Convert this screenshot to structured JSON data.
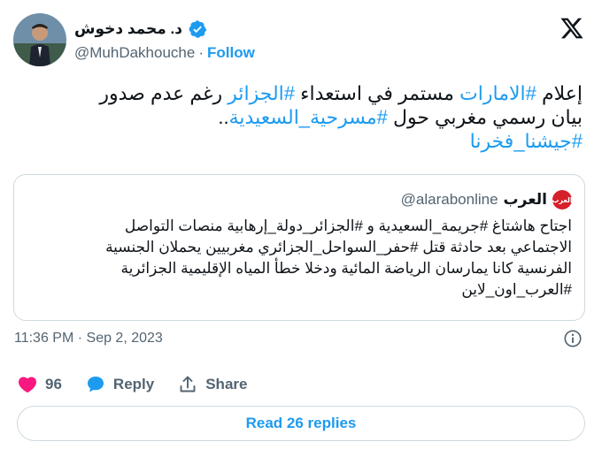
{
  "author": {
    "name": "د. محمد دخوش",
    "handle": "@MuhDakhouche",
    "separator": "·",
    "follow_label": "Follow"
  },
  "tweet": {
    "line1": [
      {
        "text": "إعلام ",
        "tag": false
      },
      {
        "text": "#الامارات",
        "tag": true
      },
      {
        "text": " مستمر في استعداء ",
        "tag": false
      },
      {
        "text": "#الجزائر",
        "tag": true
      },
      {
        "text": " رغم عدم صدور",
        "tag": false
      }
    ],
    "line2": [
      {
        "text": "بيان رسمي مغربي حول ",
        "tag": false
      },
      {
        "text": "#مسرحية_السعيدية",
        "tag": true
      },
      {
        "text": "..",
        "tag": false
      }
    ],
    "line3": [
      {
        "text": "#جيشنا_فخرنا",
        "tag": true
      }
    ]
  },
  "quote": {
    "avatar_text": "العرب",
    "name": "العرب",
    "handle": "@alarabonline",
    "text_lines": [
      "اجتاح هاشتاغ #جريمة_السعيدية  و #الجزائر_دولة_إرهابية منصات التواصل",
      "الاجتماعي بعد حادثة قتل #حفر_السواحل_الجزائري مغربيين يحملان الجنسية",
      "الفرنسية كانا يمارسان الرياضة المائية ودخلا خطأ المياه الإقليمية الجزائرية",
      "#العرب_اون_لاين"
    ]
  },
  "meta": {
    "timestamp": "11:36 PM · Sep 2, 2023"
  },
  "actions": {
    "likes": "96",
    "reply_label": "Reply",
    "share_label": "Share"
  },
  "read_replies_label": "Read 26 replies",
  "colors": {
    "accent": "#1d9bf0",
    "like": "#f91880",
    "text": "#0f1419",
    "muted": "#536471",
    "border": "#cfd9de"
  }
}
